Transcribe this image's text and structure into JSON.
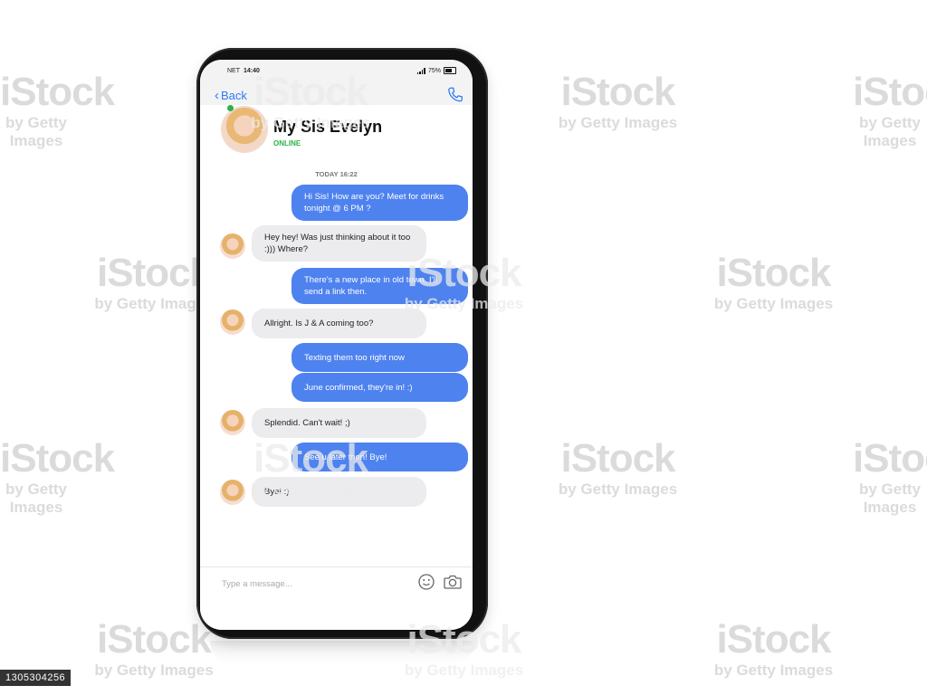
{
  "status_bar": {
    "carrier": "NET",
    "time": "14:40",
    "battery": "75%"
  },
  "nav": {
    "back_label": "Back"
  },
  "contact": {
    "name": "My Sis Evelyn",
    "status": "ONLINE"
  },
  "conversation": {
    "timestamp": "TODAY 16:22",
    "messages": [
      {
        "direction": "out",
        "text": "Hi Sis! How are you? Meet for drinks tonight @ 6 PM ?"
      },
      {
        "direction": "in",
        "text": "Hey hey! Was just thinking about it too :))) Where?"
      },
      {
        "direction": "out",
        "text": "There's a new place in old town, I'll send a link then."
      },
      {
        "direction": "in",
        "text": "Allright. Is J & A coming too?"
      },
      {
        "direction": "out",
        "text": "Texting them too right now"
      },
      {
        "direction": "out",
        "text": "June confirmed, they're in! :)"
      },
      {
        "direction": "in",
        "text": "Splendid. Can't wait! ;)"
      },
      {
        "direction": "out",
        "text": "See u later then! Bye!"
      },
      {
        "direction": "in",
        "text": "Bye! :)"
      }
    ]
  },
  "composer": {
    "placeholder": "Type a message...",
    "value": ""
  },
  "watermark": {
    "brand": "iStock",
    "byline": "by Getty Images",
    "image_id": "1305304256"
  },
  "colors": {
    "outgoing": "#4e82ef",
    "incoming": "#ececee",
    "accent": "#2f7bf5",
    "online": "#2bb24c"
  },
  "icons": [
    "phone-icon",
    "emoji-icon",
    "camera-icon",
    "chevron-left-icon"
  ]
}
